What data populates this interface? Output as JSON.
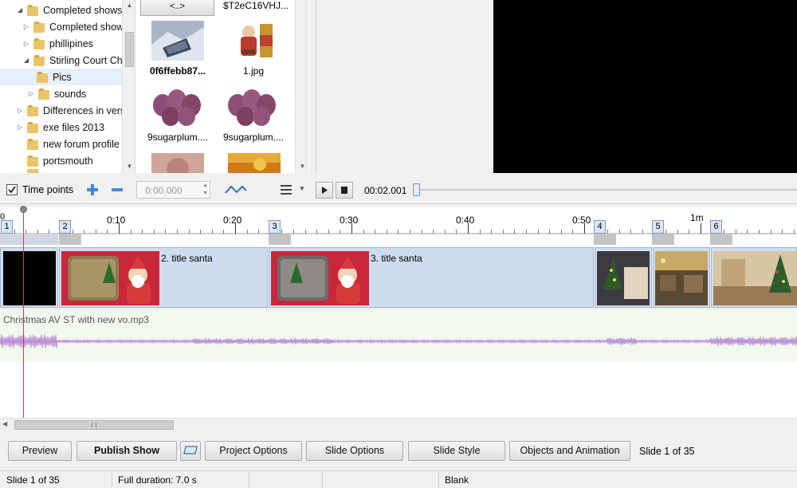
{
  "tree": {
    "items": [
      {
        "label": "Completed shows",
        "twisty": "expanded"
      },
      {
        "label": "Completed show",
        "twisty": "collapsed"
      },
      {
        "label": "phillipines",
        "twisty": "collapsed"
      },
      {
        "label": "Stirling Court Chr",
        "twisty": "expanded"
      },
      {
        "label": "Pics",
        "twisty": "none"
      },
      {
        "label": "sounds",
        "twisty": "collapsed"
      },
      {
        "label": "Differences in vers",
        "twisty": "collapsed"
      },
      {
        "label": "exe files 2013",
        "twisty": "collapsed"
      },
      {
        "label": "new forum profile",
        "twisty": "none"
      },
      {
        "label": "portsmouth",
        "twisty": "none"
      }
    ]
  },
  "files": {
    "parent_label": "<..>",
    "top_right_label": "$T2eC16VHJ...",
    "items": [
      {
        "name": "0f6ffebb87...",
        "bold": true
      },
      {
        "name": "1.jpg",
        "bold": false
      },
      {
        "name": "9sugarplum....",
        "bold": false
      },
      {
        "name": "9sugarplum....",
        "bold": false
      }
    ]
  },
  "toolbar": {
    "time_points_label": "Time points",
    "time_points_checked": true,
    "time_value": "0:00.000",
    "position": "00:02.001"
  },
  "timeline": {
    "ruler_labels": [
      "0",
      "0:10",
      "0:20",
      "0:30",
      "0:40",
      "0:50",
      "1m"
    ],
    "slide_numbers": [
      "1",
      "2",
      "3",
      "4",
      "5",
      "6"
    ],
    "slide_titles": [
      "2. title santa",
      "3. title santa"
    ],
    "audio_file": "Christmas AV ST with new vo.mp3"
  },
  "buttons": {
    "preview": "Preview",
    "publish": "Publish Show",
    "project_options": "Project Options",
    "slide_options": "Slide Options",
    "slide_style": "Slide Style",
    "objects_animation": "Objects and Animation",
    "slide_counter": "Slide 1 of 35"
  },
  "status": {
    "slide": "Slide 1 of 35",
    "duration": "Full duration: 7.0 s",
    "transition": "Blank"
  },
  "colors": {
    "selection": "#e5f0fb",
    "track_bg": "#cfdcf0",
    "audio_wave": "#b98ad6",
    "playhead": "#d24040"
  }
}
